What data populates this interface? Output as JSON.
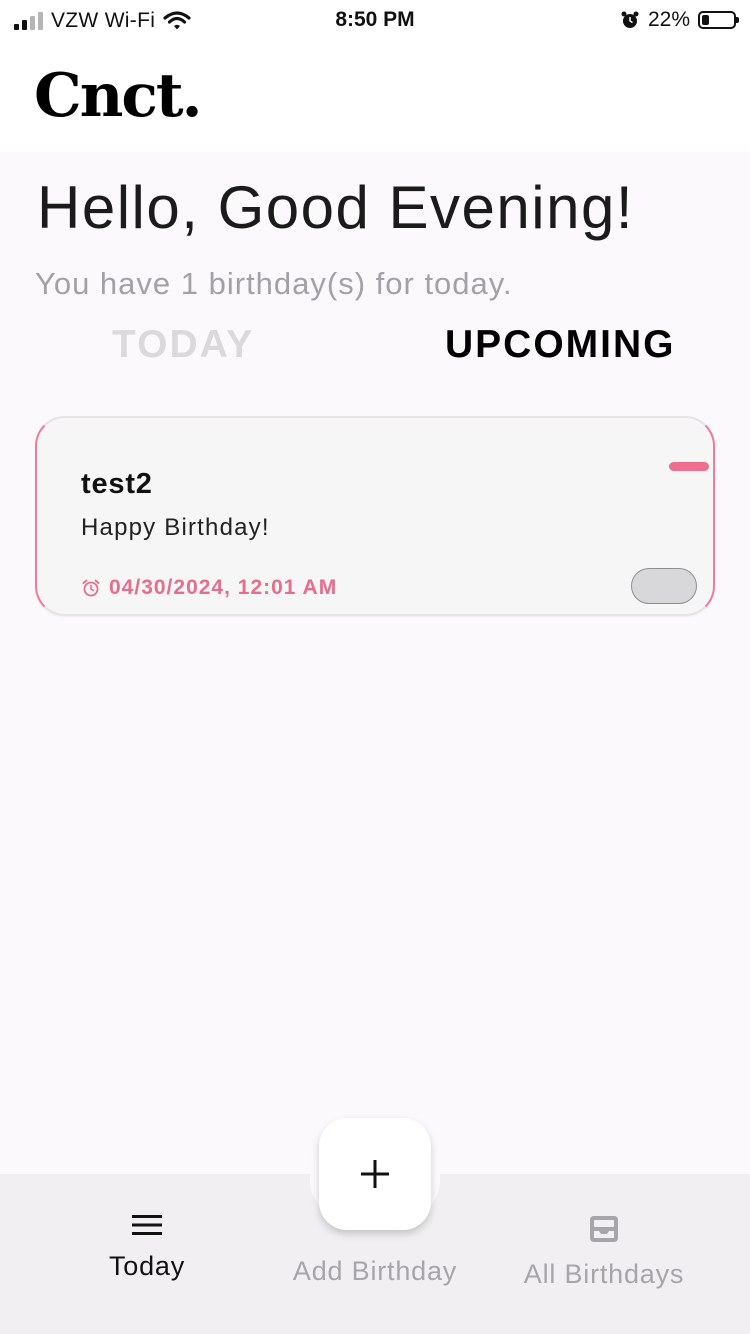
{
  "status_bar": {
    "carrier": "VZW Wi-Fi",
    "time": "8:50 PM",
    "battery_percent": "22%",
    "battery_level": 0.22,
    "icons": [
      "signal-icon",
      "wifi-icon",
      "alarm-icon",
      "battery-icon"
    ]
  },
  "header": {
    "logo": "Cnct."
  },
  "main": {
    "greeting": "Hello, Good Evening!",
    "subtitle": "You have 1 birthday(s) for today.",
    "tabs": [
      {
        "label": "TODAY",
        "active": false
      },
      {
        "label": "UPCOMING",
        "active": true
      }
    ],
    "cards": [
      {
        "name": "test2",
        "message": "Happy Birthday!",
        "datetime": "04/30/2024, 12:01 AM",
        "toggle_on": false
      }
    ]
  },
  "bottom_nav": {
    "items": [
      {
        "label": "Today",
        "icon": "menu-icon",
        "active": true
      },
      {
        "label": "Add Birthday",
        "icon": "plus-icon",
        "active": false
      },
      {
        "label": "All Birthdays",
        "icon": "inbox-icon",
        "active": false
      }
    ]
  },
  "colors": {
    "accent": "#e66d8b",
    "background": "#fbf9fc",
    "nav_background": "#f1eff2",
    "inactive_text": "#a8a5aa"
  }
}
